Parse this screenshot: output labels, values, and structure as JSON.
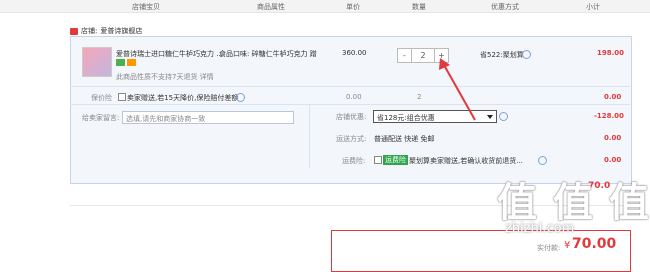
{
  "header": {
    "columns": [
      "店铺宝贝",
      "商品属性",
      "单价",
      "数量",
      "优惠方式",
      "小计"
    ]
  },
  "store": {
    "label": "店铺:",
    "name": "爱普诗旗舰店"
  },
  "item": {
    "title": "爱普诗瑞士进口糖仁牛栌巧克力 ...",
    "attribute": "食品口味: 碎糖仁牛栌巧克力 蹭",
    "price": "360.00",
    "quantity": "2",
    "discount": "省522:聚划算",
    "subtotal": "198.00",
    "return_note": "此商品性质不支持7天退货 详情"
  },
  "insurance": {
    "label": "保价险",
    "text": "卖家赠送,若15天降价,保险赔付差额",
    "price": "0.00",
    "qty": "2",
    "total": "0.00"
  },
  "message": {
    "label": "给卖家留言:",
    "placeholder": "选填,请先和商家协商一致"
  },
  "promo": {
    "label": "店铺优惠:",
    "selected": "省128元:组合优惠",
    "value": "-128.00"
  },
  "shipping": {
    "label": "运送方式:",
    "text": "普通配送 快递 免邮",
    "value": "0.00"
  },
  "freight": {
    "label": "运费险:",
    "badge": "运费险",
    "text": "聚划算卖家赠送,若确认收货前退货...",
    "value": "0.00"
  },
  "total_partial": {
    "value": "70.0"
  },
  "payment": {
    "label": "实付款:",
    "currency": "¥",
    "amount": "70.00"
  },
  "watermark": {
    "big": "值 值 值",
    "url": "zhizhi.com"
  },
  "colors": {
    "accent": "#e4393c",
    "link": "#7ea3d8",
    "panel": "#f3f6fb"
  }
}
